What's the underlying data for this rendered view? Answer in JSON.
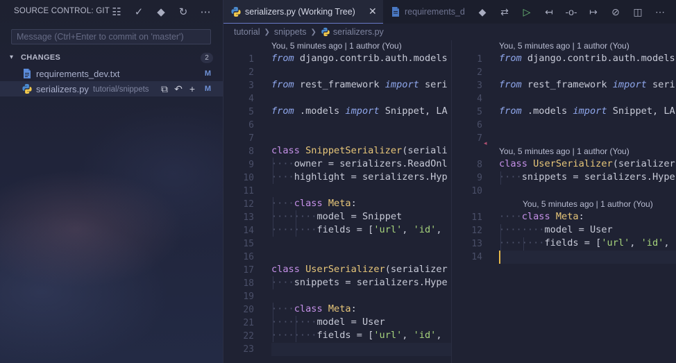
{
  "sidebar": {
    "title": "SOURCE CONTROL: GIT",
    "actions": [
      {
        "name": "view-as-tree-icon",
        "glyph": "☷"
      },
      {
        "name": "commit-check-icon",
        "glyph": "✓"
      },
      {
        "name": "git-icon",
        "glyph": "◆"
      },
      {
        "name": "refresh-icon",
        "glyph": "↻"
      },
      {
        "name": "more-actions-icon",
        "glyph": "⋯"
      }
    ],
    "commit_placeholder": "Message (Ctrl+Enter to commit on 'master')",
    "changes": {
      "label": "CHANGES",
      "count": "2",
      "files": [
        {
          "name": "requirements_dev.txt",
          "path": "",
          "status": "M",
          "icon": "file-text-icon"
        },
        {
          "name": "serializers.py",
          "path": "tutorial/snippets",
          "status": "M",
          "icon": "python-file-icon"
        }
      ]
    }
  },
  "tabs": [
    {
      "label": "serializers.py (Working Tree)",
      "active": true
    },
    {
      "label": "requirements_d",
      "active": false
    }
  ],
  "breadcrumb": [
    "tutorial",
    "snippets",
    "serializers.py"
  ],
  "left_pane": {
    "codelens": [
      {
        "line": 1,
        "text": "You, 5 minutes ago | 1 author (You)"
      }
    ],
    "lines": [
      "1",
      "2",
      "3",
      "4",
      "5",
      "6",
      "7",
      "8",
      "9",
      "10",
      "11",
      "12",
      "13",
      "14",
      "15",
      "16",
      "17",
      "18",
      "19",
      "20",
      "21",
      "22",
      "23"
    ]
  },
  "right_pane": {
    "codelens": [
      {
        "line": 1,
        "text": "You, 5 minutes ago | 1 author (You)"
      },
      {
        "line": 8,
        "text": "You, 5 minutes ago | 1 author (You)"
      },
      {
        "line": 11,
        "text": "You, 5 minutes ago | 1 author (You)"
      }
    ],
    "lines": [
      "1",
      "2",
      "3",
      "4",
      "5",
      "6",
      "7",
      "8",
      "9",
      "10",
      "11",
      "12",
      "13",
      "14"
    ]
  },
  "code_left": [
    "from django.contrib.auth.models",
    "",
    "from rest_framework import seri",
    "",
    "from .models import Snippet, LA",
    "",
    "",
    "class SnippetSerializer(seriali",
    "····owner = serializers.ReadOnl",
    "····highlight = serializers.Hyp",
    "",
    "····class Meta:",
    "········model = Snippet",
    "········fields = ['url', 'id',",
    "",
    "",
    "class UserSerializer(serializer",
    "····snippets = serializers.Hype",
    "",
    "····class Meta:",
    "········model = User",
    "········fields = ['url', 'id',",
    ""
  ],
  "code_right": [
    "from django.contrib.auth.models",
    "",
    "from rest_framework import seri",
    "",
    "from .models import Snippet, LA",
    "",
    "",
    "class UserSerializer(serializer",
    "····snippets = serializers.Hype",
    "",
    "····class Meta:",
    "········model = User",
    "········fields = ['url', 'id',",
    ""
  ],
  "colors": {
    "keyword": "#8fa7ec",
    "class_kw": "#c792ea",
    "type": "#e8c77a",
    "string": "#a6d37c",
    "status_modified": "#6f91d6",
    "cursor": "#e6b94a"
  }
}
